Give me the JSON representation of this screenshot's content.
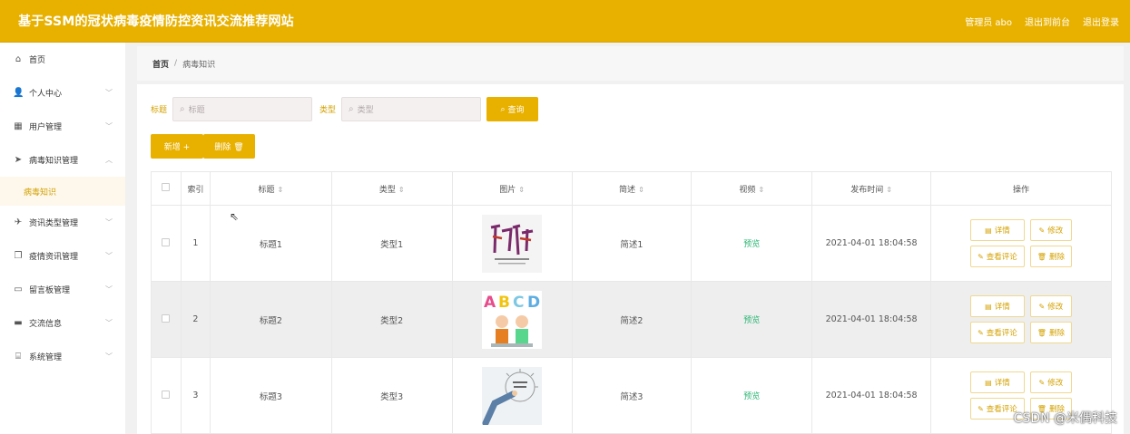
{
  "header": {
    "title": "基于SSM的冠状病毒疫情防控资讯交流推荐网站",
    "admin": "管理员 abo",
    "back_front": "退出到前台",
    "logout": "退出登录"
  },
  "sidebar": {
    "items": [
      {
        "label": "首页",
        "icon": "home-icon",
        "glyph": "⌂",
        "chevron": ""
      },
      {
        "label": "个人中心",
        "icon": "user-icon",
        "glyph": "👤",
        "chevron": "﹀"
      },
      {
        "label": "用户管理",
        "icon": "grid-icon",
        "glyph": "▦",
        "chevron": "﹀"
      },
      {
        "label": "病毒知识管理",
        "icon": "send-icon",
        "glyph": "➤",
        "chevron": "︿"
      },
      {
        "label": "资讯类型管理",
        "icon": "paper-plane-icon",
        "glyph": "✈",
        "chevron": "﹀"
      },
      {
        "label": "疫情资讯管理",
        "icon": "copy-icon",
        "glyph": "❐",
        "chevron": "﹀"
      },
      {
        "label": "留言板管理",
        "icon": "message-icon",
        "glyph": "▭",
        "chevron": "﹀"
      },
      {
        "label": "交流信息",
        "icon": "board-icon",
        "glyph": "▬",
        "chevron": "﹀"
      },
      {
        "label": "系统管理",
        "icon": "system-icon",
        "glyph": "⌸",
        "chevron": "﹀"
      }
    ],
    "sub_item": "病毒知识"
  },
  "breadcrumb": {
    "home": "首页",
    "sep": "/",
    "current": "病毒知识"
  },
  "search": {
    "title_label": "标题",
    "title_placeholder": "标题",
    "type_label": "类型",
    "type_placeholder": "类型",
    "query_button": "查询"
  },
  "actions": {
    "add": "新增 +",
    "delete": "删除 🗑"
  },
  "table": {
    "headers": {
      "index": "索引",
      "title": "标题",
      "type": "类型",
      "image": "图片",
      "summary": "简述",
      "video": "视频",
      "published": "发布时间",
      "operation": "操作"
    },
    "rows": [
      {
        "index": "1",
        "title": "标题1",
        "type": "类型1",
        "summary": "简述1",
        "video": "预览",
        "published": "2021-04-01 18:04:58"
      },
      {
        "index": "2",
        "title": "标题2",
        "type": "类型2",
        "summary": "简述2",
        "video": "预览",
        "published": "2021-04-01 18:04:58"
      },
      {
        "index": "3",
        "title": "标题3",
        "type": "类型3",
        "summary": "简述3",
        "video": "预览",
        "published": "2021-04-01 18:04:58"
      }
    ],
    "ops": {
      "detail": "详情",
      "edit": "修改",
      "comments": "查看评论",
      "delete": "删除"
    }
  },
  "watermark": "CSDN @米偶科技",
  "colors": {
    "brand": "#e8b100",
    "accent_text": "#d4a200",
    "preview_link": "#2bb673"
  }
}
